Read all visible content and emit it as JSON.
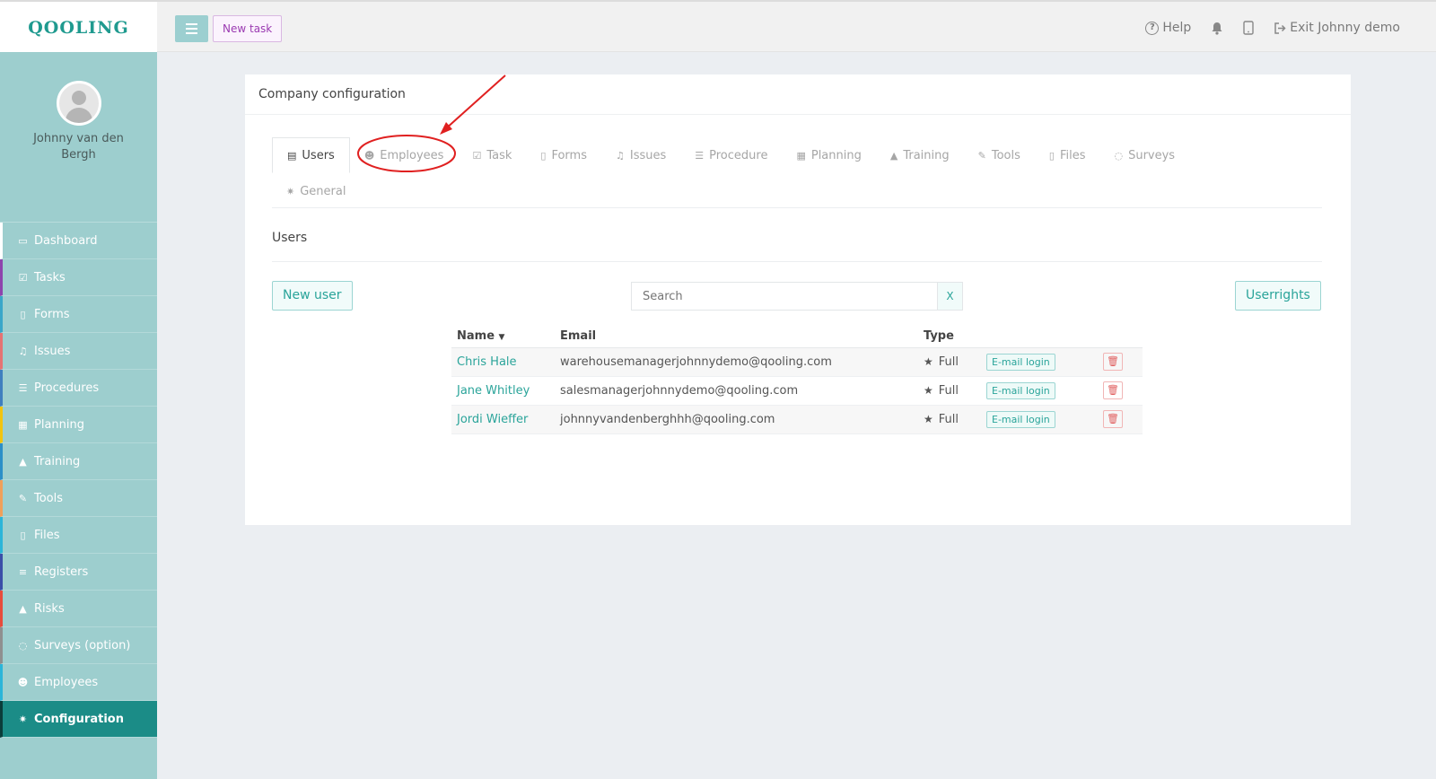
{
  "app": {
    "logo": "QOOLING"
  },
  "topbar": {
    "new_task_label": "New task",
    "help_label": "Help",
    "exit_label": "Exit Johnny demo"
  },
  "profile": {
    "name": "Johnny van den Bergh"
  },
  "sidebar": {
    "items": [
      {
        "label": "Dashboard",
        "icon": "monitor-icon",
        "color": "#ffffff"
      },
      {
        "label": "Tasks",
        "icon": "checkbox-icon",
        "color": "#8e44ad"
      },
      {
        "label": "Forms",
        "icon": "document-icon",
        "color": "#3aa6c9"
      },
      {
        "label": "Issues",
        "icon": "bell-icon",
        "color": "#e57373"
      },
      {
        "label": "Procedures",
        "icon": "list-icon",
        "color": "#3f7fbf"
      },
      {
        "label": "Planning",
        "icon": "calendar-icon",
        "color": "#f1c40f"
      },
      {
        "label": "Training",
        "icon": "graduation-cap-icon",
        "color": "#2c8fc7"
      },
      {
        "label": "Tools",
        "icon": "wrench-icon",
        "color": "#f0a05a"
      },
      {
        "label": "Files",
        "icon": "file-icon",
        "color": "#2bb5d9"
      },
      {
        "label": "Registers",
        "icon": "lines-icon",
        "color": "#3b4fa8"
      },
      {
        "label": "Risks",
        "icon": "warning-icon",
        "color": "#e74c3c"
      },
      {
        "label": "Surveys (option)",
        "icon": "chat-icon",
        "color": "#8f8f8f"
      },
      {
        "label": "Employees",
        "icon": "users-icon",
        "color": "#2bb5d9"
      },
      {
        "label": "Configuration",
        "icon": "gear-icon",
        "color": "#0b3d3b"
      }
    ]
  },
  "card": {
    "title": "Company configuration",
    "tabs": [
      {
        "label": "Users",
        "icon": "id-card-icon"
      },
      {
        "label": "Employees",
        "icon": "users-icon"
      },
      {
        "label": "Task",
        "icon": "checkbox-icon"
      },
      {
        "label": "Forms",
        "icon": "document-icon"
      },
      {
        "label": "Issues",
        "icon": "bell-icon"
      },
      {
        "label": "Procedure",
        "icon": "list-icon"
      },
      {
        "label": "Planning",
        "icon": "calendar-icon"
      },
      {
        "label": "Training",
        "icon": "graduation-cap-icon"
      },
      {
        "label": "Tools",
        "icon": "wrench-icon"
      },
      {
        "label": "Files",
        "icon": "file-icon"
      },
      {
        "label": "Surveys",
        "icon": "chat-icon"
      },
      {
        "label": "General",
        "icon": "gear-icon"
      }
    ],
    "section_title": "Users",
    "new_user_label": "New user",
    "search_placeholder": "Search",
    "search_clear_label": "X",
    "userrights_label": "Userrights",
    "table": {
      "headers": {
        "name": "Name",
        "email": "Email",
        "type": "Type"
      },
      "rows": [
        {
          "name": "Chris Hale",
          "email": "warehousemanagerjohnnydemo@qooling.com",
          "type": "Full",
          "login": "E-mail login"
        },
        {
          "name": "Jane Whitley",
          "email": "salesmanagerjohnnydemo@qooling.com",
          "type": "Full",
          "login": "E-mail login"
        },
        {
          "name": "Jordi Wieffer",
          "email": "johnnyvandenberghhh@qooling.com",
          "type": "Full",
          "login": "E-mail login"
        }
      ]
    }
  },
  "annotation": {
    "color": "#e02020",
    "target": "Employees"
  }
}
